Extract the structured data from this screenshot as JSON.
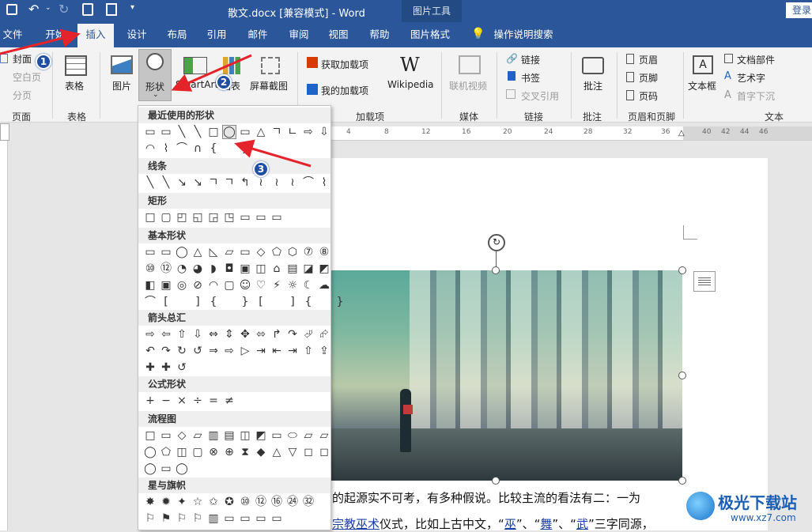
{
  "titlebar": {
    "doc_title": "散文.docx [兼容模式]  -  Word",
    "context_tab": "图片工具",
    "login": "登录"
  },
  "tabs": [
    "文件",
    "开始",
    "插入",
    "设计",
    "布局",
    "引用",
    "邮件",
    "审阅",
    "视图",
    "帮助",
    "图片格式",
    "操作说明搜索"
  ],
  "ribbon": {
    "pages": {
      "items": [
        "封面",
        "空白页",
        "分页"
      ],
      "group": "页面"
    },
    "tables": {
      "label": "表格",
      "group": "表格"
    },
    "illustrations": {
      "picture": "图片",
      "shapes": "形状",
      "smartart": "SmartArt",
      "chart": "图表",
      "screenshot": "屏幕截图"
    },
    "addins": {
      "get": "获取加载项",
      "mine": "我的加载项",
      "wikipedia": "Wikipedia",
      "group": "加载项"
    },
    "media": {
      "video": "联机视频",
      "group": "媒体"
    },
    "links": {
      "link": "链接",
      "bookmark": "书签",
      "crossref": "交叉引用",
      "group": "链接"
    },
    "comments": {
      "comment": "批注",
      "group": "批注"
    },
    "headerfooter": {
      "header": "页眉",
      "footer": "页脚",
      "pagenum": "页码",
      "group": "页眉和页脚"
    },
    "text": {
      "textbox": "文本框",
      "parts": "文档部件",
      "wordart": "艺术字",
      "dropcap": "首字下沉",
      "group": "文本"
    }
  },
  "ruler_ticks": [
    "4",
    "8",
    "12",
    "16",
    "20",
    "24",
    "28",
    "32",
    "36",
    "40",
    "42",
    "44",
    "46"
  ],
  "menu": {
    "sections": [
      "最近使用的形状",
      "线条",
      "矩形",
      "基本形状",
      "箭头总汇",
      "公式形状",
      "流程图",
      "星与旗帜"
    ]
  },
  "badges": [
    "1",
    "2",
    "3"
  ],
  "document": {
    "line1": "的起源实不可考，有多种假说。比较主流的看法有二：一为",
    "line2_pre": "宗教",
    "line2_link1": "巫术",
    "line2_mid": "仪式，比如上古中文，“",
    "line2_w1": "巫",
    "line2_s1": "”、“",
    "line2_w2": "舞",
    "line2_s2": "”、“",
    "line2_w3": "武",
    "line2_end": "”三字同源，"
  },
  "watermark": {
    "brand": "极光下载站",
    "url": "www.xz7.com"
  },
  "colors": {
    "title_blue": "#2b579a",
    "badge_blue": "#1f4ea3",
    "arrow_red": "#e5232b"
  }
}
